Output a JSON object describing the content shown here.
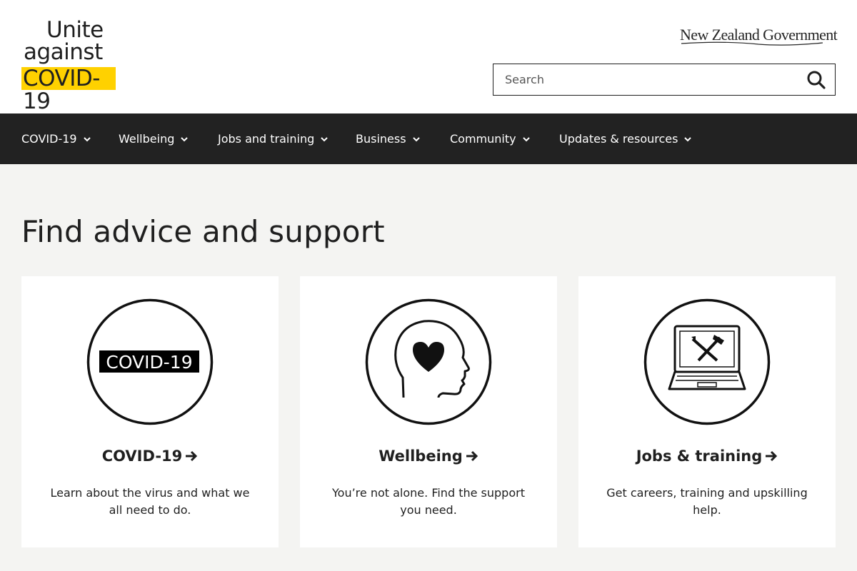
{
  "brand": {
    "logo_line1": "Unite",
    "logo_line2": "against",
    "logo_line3": "COVID-19",
    "highlight_color": "#ffd100",
    "government": "New Zealand Government"
  },
  "search": {
    "placeholder": "Search",
    "value": ""
  },
  "nav": {
    "items": [
      {
        "label": "COVID-19"
      },
      {
        "label": "Wellbeing"
      },
      {
        "label": "Jobs and training"
      },
      {
        "label": "Business"
      },
      {
        "label": "Community"
      },
      {
        "label": "Updates & resources"
      }
    ]
  },
  "main": {
    "title": "Find advice and support",
    "cards": [
      {
        "icon": "covid-badge-icon",
        "badge_text": "COVID-19",
        "title": "COVID-19",
        "desc": "Learn about the virus and what we all need to do."
      },
      {
        "icon": "head-heart-icon",
        "title": "Wellbeing",
        "desc": "You’re not alone. Find the support you need."
      },
      {
        "icon": "laptop-tools-icon",
        "title": "Jobs & training",
        "desc": "Get careers, training and upskilling help."
      }
    ]
  },
  "colors": {
    "nav_bg": "#222222",
    "page_bg": "#f4f4f2",
    "text": "#1f1f1f"
  }
}
